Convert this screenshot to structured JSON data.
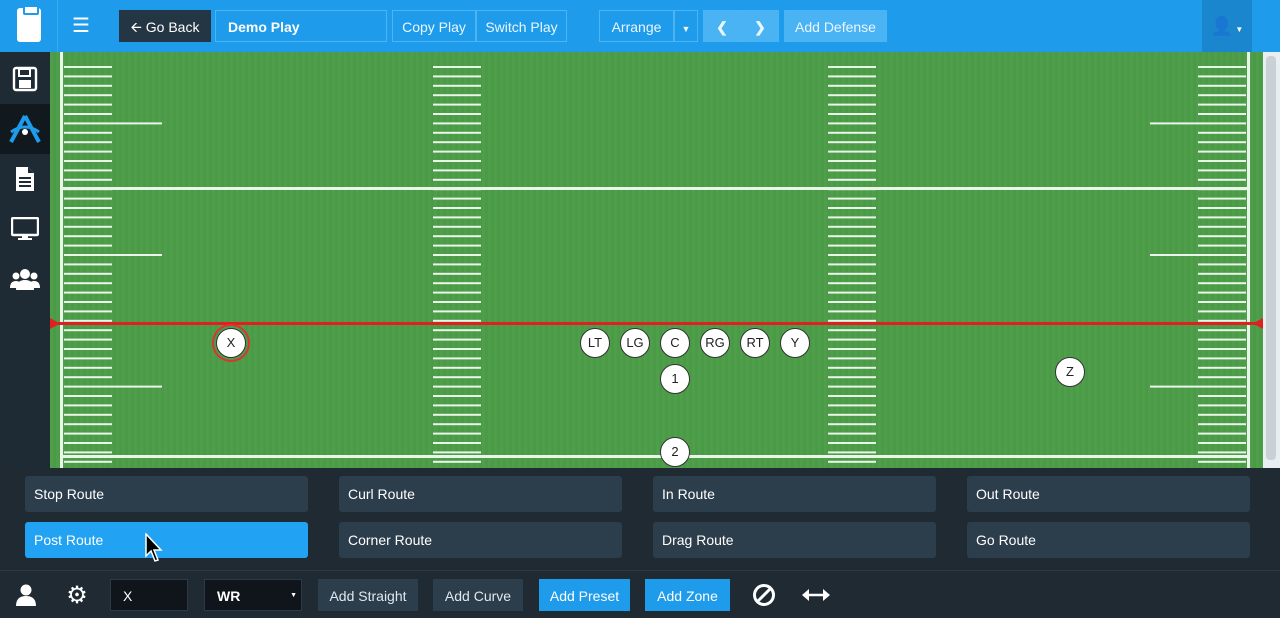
{
  "topbar": {
    "go_back_label": "Go Back",
    "play_name": "Demo Play",
    "copy_play_label": "Copy Play",
    "switch_play_label": "Switch Play",
    "arrange_label": "Arrange",
    "add_defense_label": "Add Defense"
  },
  "sidebar": {
    "items": [
      {
        "icon": "save-icon"
      },
      {
        "icon": "playbook-logo-icon",
        "active": true
      },
      {
        "icon": "document-icon"
      },
      {
        "icon": "monitor-icon"
      },
      {
        "icon": "users-icon"
      }
    ]
  },
  "field": {
    "line_of_scrimmage_color": "#e02020",
    "players": [
      {
        "label": "X",
        "selected": true
      },
      {
        "label": "LT"
      },
      {
        "label": "LG"
      },
      {
        "label": "C"
      },
      {
        "label": "RG"
      },
      {
        "label": "RT"
      },
      {
        "label": "Y"
      },
      {
        "label": "1"
      },
      {
        "label": "Z"
      },
      {
        "label": "2"
      }
    ]
  },
  "routes": {
    "row1": [
      "Stop Route",
      "Curl Route",
      "In Route",
      "Out Route"
    ],
    "row2": [
      "Post Route",
      "Corner Route",
      "Drag Route",
      "Go Route"
    ],
    "active": "Post Route"
  },
  "bottombar": {
    "player_label_value": "X",
    "position_value": "WR",
    "add_straight_label": "Add Straight",
    "add_curve_label": "Add Curve",
    "add_preset_label": "Add Preset",
    "add_zone_label": "Add Zone"
  },
  "colors": {
    "accent": "#1e9bea",
    "panel": "#1f2a33",
    "field": "#4b9a47"
  }
}
